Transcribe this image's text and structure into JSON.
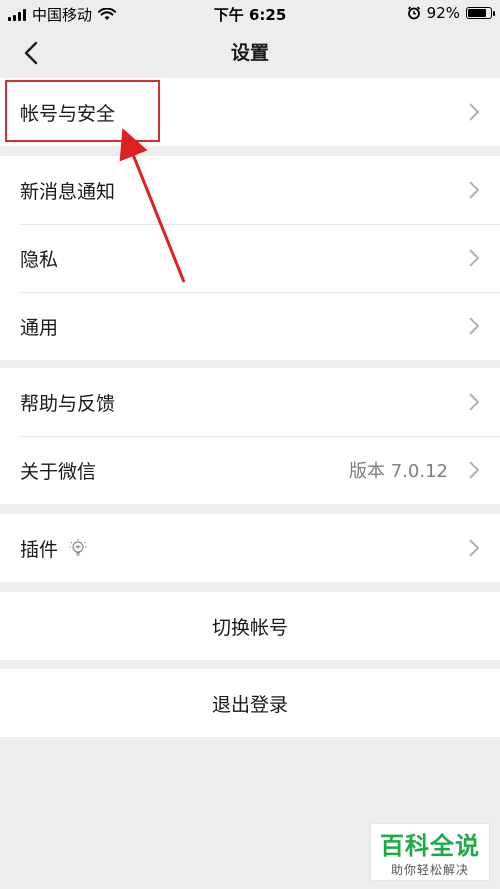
{
  "status_bar": {
    "carrier": "中国移动",
    "time": "下午 6:25",
    "battery": "92%",
    "battery_level": 0.92
  },
  "nav": {
    "title": "设置"
  },
  "groups": {
    "account": {
      "label": "帐号与安全"
    },
    "notify": [
      {
        "label": "新消息通知"
      },
      {
        "label": "隐私"
      },
      {
        "label": "通用"
      }
    ],
    "help": [
      {
        "label": "帮助与反馈"
      },
      {
        "label": "关于微信",
        "value": "版本 7.0.12"
      }
    ],
    "plugins": {
      "label": "插件",
      "icon": "lightbulb-icon"
    },
    "switch_account": {
      "label": "切换帐号"
    },
    "logout": {
      "label": "退出登录"
    }
  },
  "watermark": {
    "title": "百科全说",
    "subtitle": "助你轻松解决"
  },
  "colors": {
    "background": "#ededed",
    "highlight": "#d32f2f",
    "watermark_green": "#1faa4a"
  }
}
